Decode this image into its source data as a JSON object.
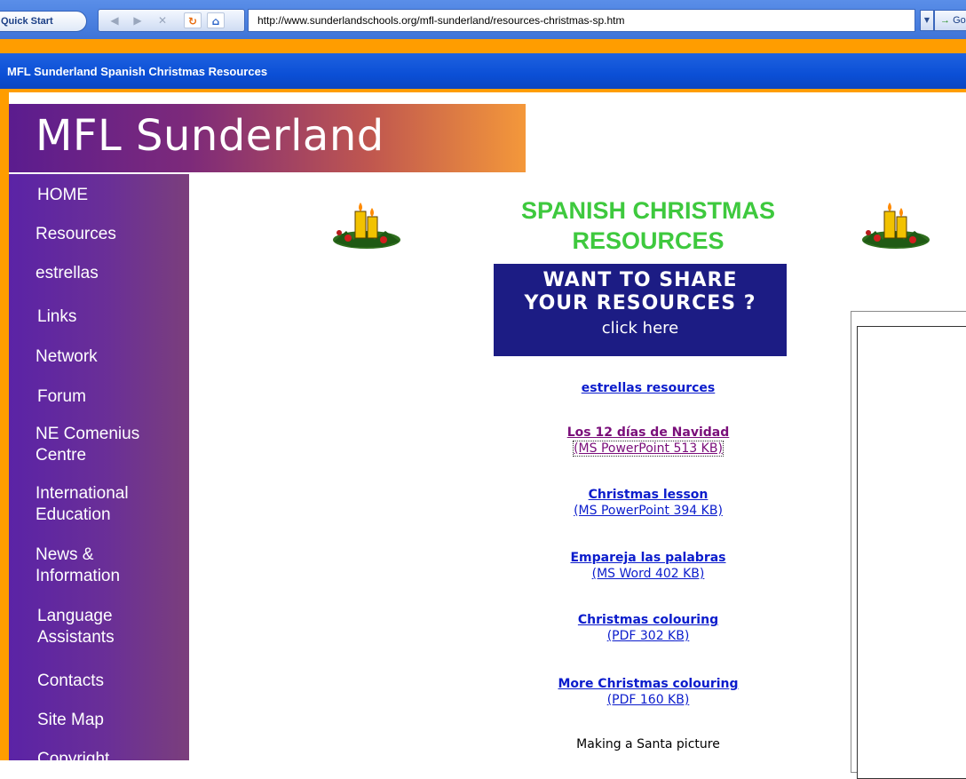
{
  "browser": {
    "quick_start": "Quick Start",
    "url": "http://www.sunderlandschools.org/mfl-sunderland/resources-christmas-sp.htm",
    "go_label": "Go",
    "window_title": "MFL Sunderland Spanish Christmas Resources"
  },
  "site": {
    "logo_text": "MFL Sunderland"
  },
  "sidebar": {
    "items": [
      {
        "label": "HOME"
      },
      {
        "label": "Resources"
      },
      {
        "label": "estrellas"
      },
      {
        "label": "Links"
      },
      {
        "label": "Network"
      },
      {
        "label": "Forum"
      },
      {
        "label": "NE Comenius",
        "label2": "Centre"
      },
      {
        "label": "International",
        "label2": "Education"
      },
      {
        "label": "News &",
        "label2": "Information"
      },
      {
        "label": "Language",
        "label2": "Assistants"
      },
      {
        "label": "Contacts"
      },
      {
        "label": "Site Map"
      },
      {
        "label": "Copyright"
      }
    ]
  },
  "main": {
    "heading_line1": "SPANISH CHRISTMAS",
    "heading_line2": "RESOURCES",
    "share_banner": {
      "line1": "WANT TO SHARE",
      "line2": "YOUR RESOURCES ?",
      "line3": "click here"
    },
    "resources": [
      {
        "title": "estrellas resources",
        "info": ""
      },
      {
        "title": "Los 12 días de Navidad",
        "info": "(MS PowerPoint 513 KB)"
      },
      {
        "title": "Christmas lesson",
        "info": "(MS PowerPoint 394 KB)"
      },
      {
        "title": "Empareja las palabras",
        "info": "(MS Word 402 KB)"
      },
      {
        "title": "Christmas colouring",
        "info": "(PDF 302 KB)"
      },
      {
        "title": "More Christmas colouring",
        "info": "(PDF 160 KB)"
      }
    ],
    "plain_text": "Making a Santa picture"
  },
  "colors": {
    "heading": "#3ec93e",
    "link": "#0b1ccc",
    "visited": "#7a0e7a",
    "banner": "#1c1c84",
    "titlebar": "#0b4fd6",
    "frame_orange": "#ff9d00"
  }
}
